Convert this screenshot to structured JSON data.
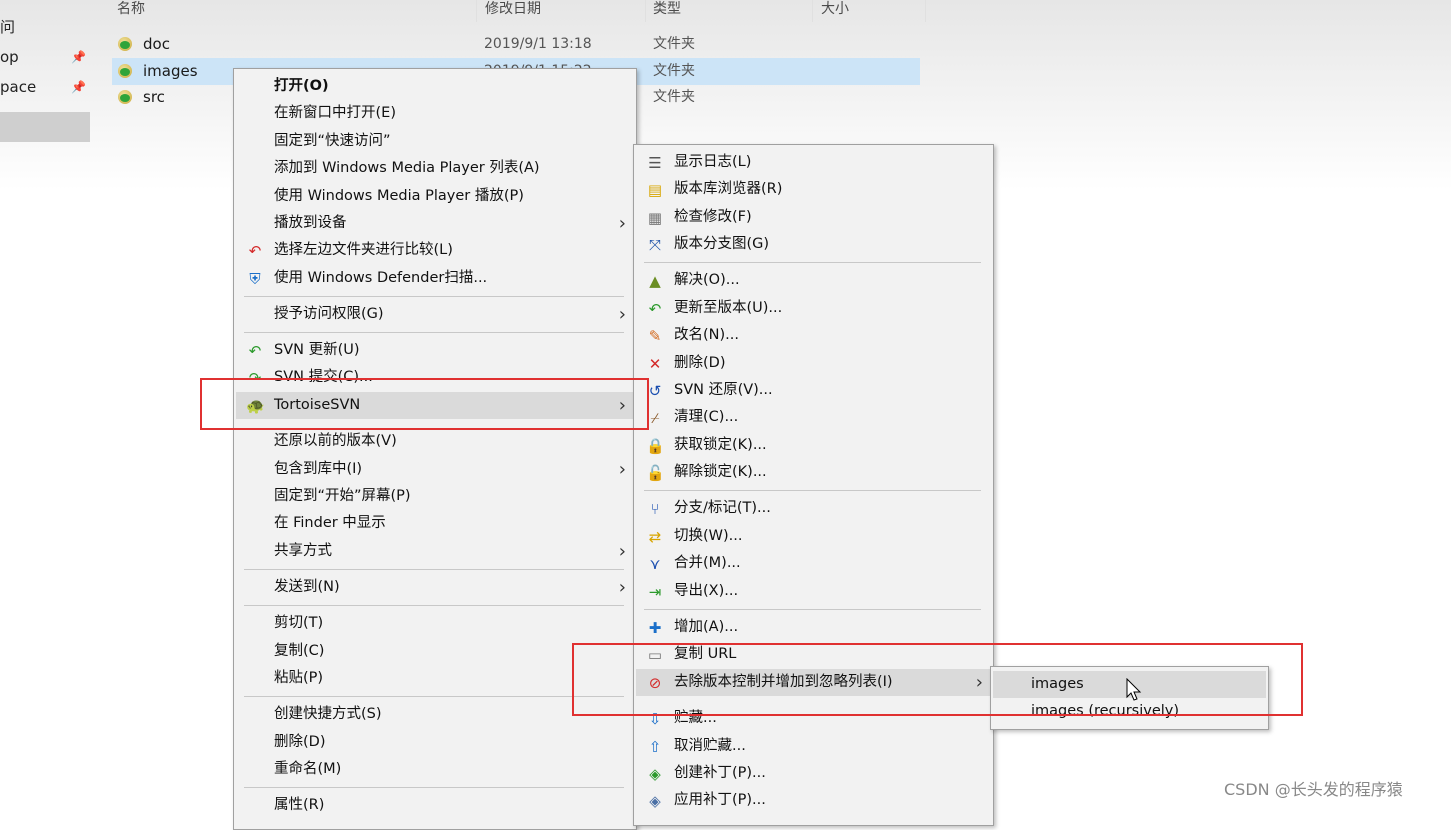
{
  "nav": {
    "items": [
      {
        "label": "问",
        "pinned": false
      },
      {
        "label": "op",
        "pinned": true
      },
      {
        "label": "pace",
        "pinned": true
      }
    ]
  },
  "columns": [
    "名称",
    "修改日期",
    "类型",
    "大小"
  ],
  "files": [
    {
      "name": "doc",
      "date": "2019/9/1 13:18",
      "type": "文件夹",
      "selected": false
    },
    {
      "name": "images",
      "date": "2019/9/1 15:22",
      "type": "文件夹",
      "selected": true
    },
    {
      "name": "src",
      "date": "",
      "type": "文件夹",
      "selected": false
    }
  ],
  "context_menu": {
    "items": [
      {
        "label": "打开(O)",
        "bold": true
      },
      {
        "label": "在新窗口中打开(E)"
      },
      {
        "label": "固定到“快速访问”"
      },
      {
        "label": "添加到 Windows Media Player 列表(A)"
      },
      {
        "label": "使用 Windows Media Player 播放(P)"
      },
      {
        "label": "播放到设备",
        "submenu": true
      },
      {
        "label": "选择左边文件夹进行比较(L)",
        "icon": "compare-icon"
      },
      {
        "label": "使用 Windows Defender扫描...",
        "icon": "defender-shield-icon"
      },
      {
        "label": "授予访问权限(G)",
        "submenu": true
      },
      {
        "label": "SVN 更新(U)",
        "icon": "svn-update-icon"
      },
      {
        "label": "SVN 提交(C)...",
        "icon": "svn-commit-icon"
      },
      {
        "label": "TortoiseSVN",
        "icon": "tortoisesvn-icon",
        "submenu": true,
        "highlighted": true
      },
      {
        "label": "还原以前的版本(V)"
      },
      {
        "label": "包含到库中(I)",
        "submenu": true
      },
      {
        "label": "固定到“开始”屏幕(P)"
      },
      {
        "label": "在 Finder 中显示"
      },
      {
        "label": "共享方式",
        "submenu": true
      },
      {
        "label": "发送到(N)",
        "submenu": true
      },
      {
        "label": "剪切(T)"
      },
      {
        "label": "复制(C)"
      },
      {
        "label": "粘贴(P)"
      },
      {
        "label": "创建快捷方式(S)"
      },
      {
        "label": "删除(D)"
      },
      {
        "label": "重命名(M)"
      },
      {
        "label": "属性(R)"
      }
    ]
  },
  "svn_menu": {
    "items": [
      {
        "label": "显示日志(L)",
        "icon": "log-icon"
      },
      {
        "label": "版本库浏览器(R)",
        "icon": "repo-browser-icon"
      },
      {
        "label": "检查修改(F)",
        "icon": "check-modifications-icon"
      },
      {
        "label": "版本分支图(G)",
        "icon": "revision-graph-icon"
      },
      {
        "label": "解决(O)...",
        "icon": "resolve-icon"
      },
      {
        "label": "更新至版本(U)...",
        "icon": "update-to-revision-icon"
      },
      {
        "label": "改名(N)...",
        "icon": "rename-icon"
      },
      {
        "label": "删除(D)",
        "icon": "delete-icon"
      },
      {
        "label": "SVN 还原(V)...",
        "icon": "revert-icon"
      },
      {
        "label": "清理(C)...",
        "icon": "cleanup-icon"
      },
      {
        "label": "获取锁定(K)...",
        "icon": "lock-icon"
      },
      {
        "label": "解除锁定(K)...",
        "icon": "unlock-icon"
      },
      {
        "label": "分支/标记(T)...",
        "icon": "branch-icon"
      },
      {
        "label": "切换(W)...",
        "icon": "switch-icon"
      },
      {
        "label": "合并(M)...",
        "icon": "merge-icon"
      },
      {
        "label": "导出(X)...",
        "icon": "export-icon"
      },
      {
        "label": "增加(A)...",
        "icon": "add-icon"
      },
      {
        "label": "复制 URL",
        "icon": "copy-url-icon"
      },
      {
        "label": "去除版本控制并增加到忽略列表(I)",
        "icon": "ignore-icon",
        "submenu": true,
        "highlighted": true
      },
      {
        "label": "贮藏...",
        "icon": "shelve-icon"
      },
      {
        "label": "取消贮藏...",
        "icon": "unshelve-icon"
      },
      {
        "label": "创建补丁(P)...",
        "icon": "create-patch-icon"
      },
      {
        "label": "应用补丁(P)...",
        "icon": "apply-patch-icon"
      }
    ]
  },
  "ignore_menu": {
    "items": [
      {
        "label": "images",
        "highlighted": true
      },
      {
        "label": "images (recursively)"
      }
    ]
  },
  "watermark": "CSDN @长头发的程序猿",
  "colors": {
    "selection": "#cce4f7",
    "annotation_red": "#e03131",
    "menu_bg": "#f2f2f2",
    "menu_highlight": "#dadada"
  }
}
